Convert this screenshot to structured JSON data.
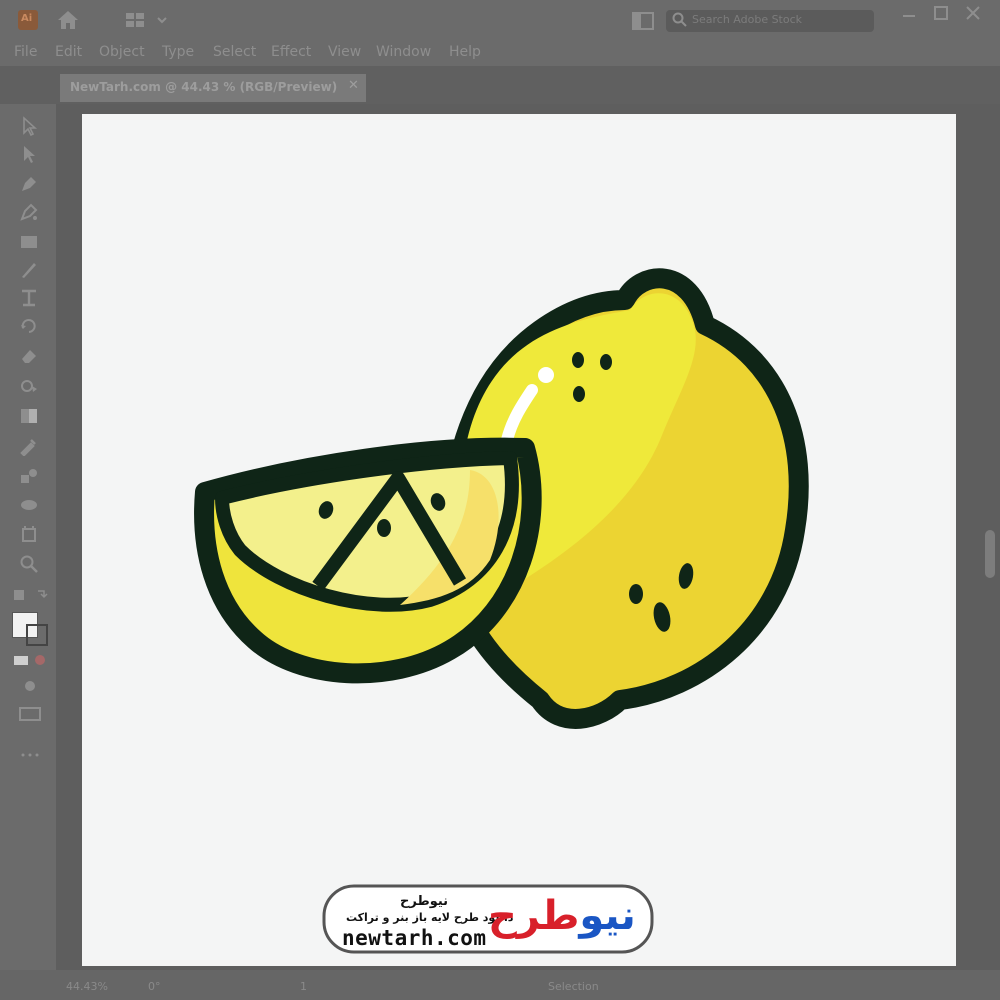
{
  "app": {
    "logo_label": "Ai",
    "document_tab": "NewTarh.com @ 44.43 % (RGB/Preview)",
    "close_glyph": "✕",
    "search_placeholder": "Search Adobe Stock",
    "zoom": "44.43%",
    "rotation": "0°",
    "artboard_number": "1",
    "tool_status": "Selection"
  },
  "menu": [
    "File",
    "Edit",
    "Object",
    "Type",
    "Select",
    "Effect",
    "View",
    "Window",
    "Help"
  ],
  "tools": [
    "selection-icon",
    "direct-selection-icon",
    "pen-icon",
    "curvature-icon",
    "rectangle-icon",
    "paintbrush-icon",
    "type-icon",
    "rotate-icon",
    "eraser-icon",
    "shape-builder-icon",
    "gradient-icon",
    "eyedropper-icon",
    "blend-icon",
    "symbol-sprayer-icon",
    "artboard-icon",
    "zoom-icon"
  ],
  "watermark": {
    "url": "newtarh.com",
    "title_fa": "نیوطرح",
    "tagline_fa": "دانلود طرح لایه باز بنر و تراکت",
    "brand_blue": "نیو",
    "brand_red": "طرح"
  },
  "colors": {
    "outline": "#0f2517",
    "lemon_light": "#efe93a",
    "lemon_dark": "#ecd432",
    "slice_light": "#f3f08c",
    "slice_peach": "#f6e06a",
    "slice_rind": "#efe43c",
    "highlight": "#ffffff",
    "brand_blue": "#1a56c4",
    "brand_red": "#d8202a"
  }
}
